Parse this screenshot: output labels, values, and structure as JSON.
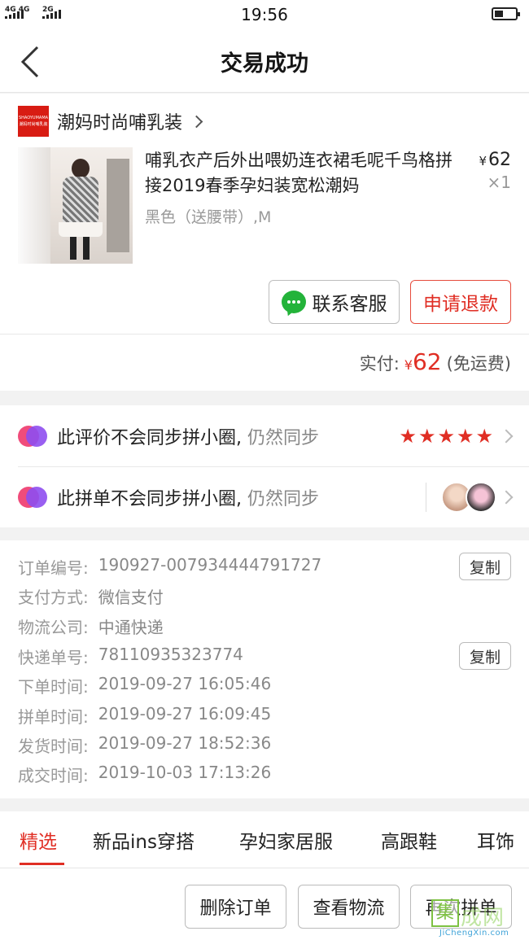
{
  "status_bar": {
    "net1": "4G 4G",
    "net2": "2G",
    "time": "19:56"
  },
  "header": {
    "title": "交易成功"
  },
  "shop": {
    "logo_text": "SHAOYUMAMA 潮妈时尚哺乳装",
    "name": "潮妈时尚哺乳装"
  },
  "product": {
    "name": "哺乳衣产后外出喂奶连衣裙毛呢千鸟格拼接2019春季孕妇装宽松潮妈",
    "variant": "黑色（送腰带）,M",
    "currency": "¥",
    "price": "62",
    "quantity": "×1"
  },
  "actions": {
    "contact_service": "联系客服",
    "request_refund": "申请退款"
  },
  "payment": {
    "label": "实付:",
    "currency": "¥",
    "amount": "62",
    "note": "(免运费)"
  },
  "sync_rows": [
    {
      "text": "此评价不会同步拼小圈,",
      "muted": " 仍然同步",
      "rating": 5
    },
    {
      "text": "此拼单不会同步拼小圈,",
      "muted": " 仍然同步"
    }
  ],
  "order_info": [
    {
      "label": "订单编号:",
      "value": "190927-007934444791727",
      "copy": "复制"
    },
    {
      "label": "支付方式:",
      "value": "微信支付"
    },
    {
      "label": "物流公司:",
      "value": "中通快递"
    },
    {
      "label": "快递单号:",
      "value": "78110935323774",
      "copy": "复制"
    },
    {
      "label": "下单时间:",
      "value": "2019-09-27 16:05:46"
    },
    {
      "label": "拼单时间:",
      "value": "2019-09-27 16:09:45"
    },
    {
      "label": "发货时间:",
      "value": "2019-09-27 18:52:36"
    },
    {
      "label": "成交时间:",
      "value": "2019-10-03 17:13:26"
    }
  ],
  "tabs": [
    "精选",
    "新品ins穿搭",
    "孕妇家居服",
    "高跟鞋",
    "耳饰"
  ],
  "bottom_actions": [
    "删除订单",
    "查看物流",
    "再次拼单"
  ],
  "watermark": {
    "mark": "集",
    "text": "成网",
    "url": "JiChengXin.com"
  },
  "colors": {
    "accent": "#e02e24",
    "wechat_green": "#23b33a"
  }
}
